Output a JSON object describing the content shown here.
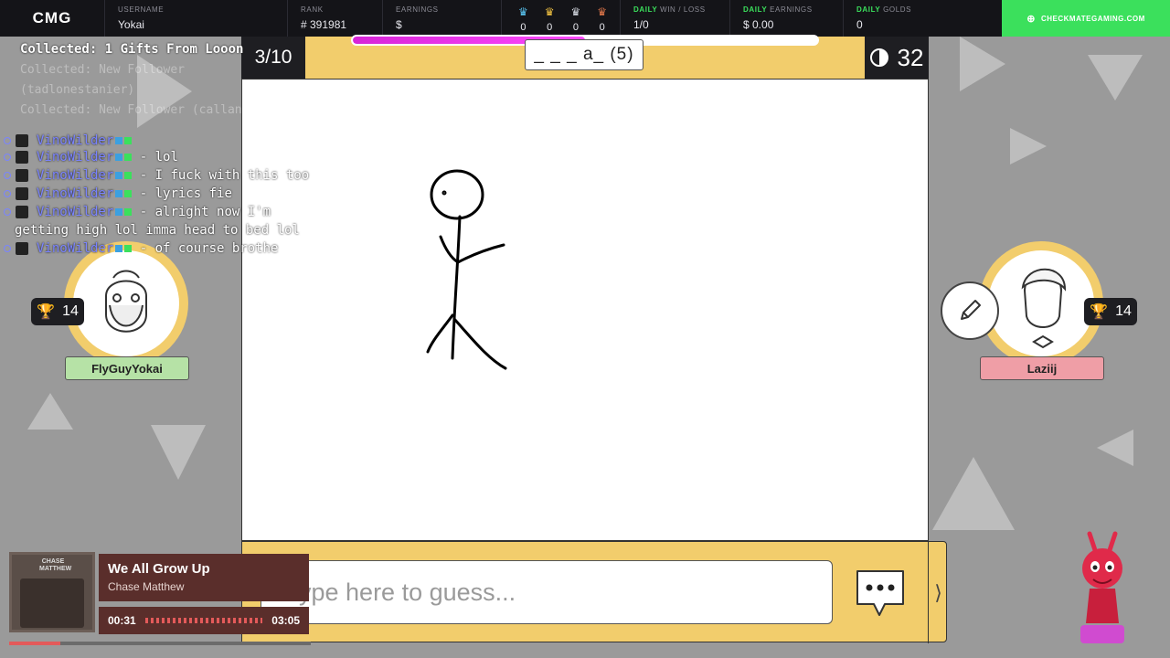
{
  "topbar": {
    "brand": "CMG",
    "username_label": "USERNAME",
    "username": "Yokai",
    "rank_label": "RANK",
    "rank": "# 391981",
    "earnings_label": "EARNINGS",
    "earnings": "$",
    "crowns": [
      {
        "icon": "crown-icon",
        "color": "#5bc8f5",
        "value": "0"
      },
      {
        "icon": "crown-icon",
        "color": "#f5c542",
        "value": "0"
      },
      {
        "icon": "crown-icon",
        "color": "#d7dbe3",
        "value": "0"
      },
      {
        "icon": "crown-icon",
        "color": "#e0774a",
        "value": "0"
      }
    ],
    "daily_wl_label_hl": "DAILY",
    "daily_wl_label": " WIN / LOSS",
    "daily_wl": "1/0",
    "daily_earn_label_hl": "DAILY",
    "daily_earn_label": " EARNINGS",
    "daily_earn": "$ 0.00",
    "daily_golds_label_hl": "DAILY",
    "daily_golds_label": " GOLDS",
    "daily_golds": "0",
    "cta": "CHECKMATEGAMING.COM"
  },
  "game": {
    "round": "3/10",
    "word_hint": "_ _ _ a_ (5)",
    "progress_fraction": 0.5,
    "timer": "32",
    "guess_placeholder": "Type here to guess..."
  },
  "players": {
    "left": {
      "name": "FlyGuyYokai",
      "trophies": "14",
      "name_color": "#b6e2a6"
    },
    "right": {
      "name": "Laziij",
      "trophies": "14",
      "name_color": "#ef9ea6"
    }
  },
  "chat": {
    "collected_label": "Collected:",
    "collected_text": "1 Gifts From Looon",
    "faded": [
      "Collected: New Follower",
      "(tadlonestanier)",
      "Collected: New Follower (callan15)"
    ],
    "messages": [
      {
        "user": "VinoWilder",
        "text": ""
      },
      {
        "user": "VinoWilder",
        "text": "- lol"
      },
      {
        "user": "VinoWilder",
        "text": "- I fuck with this too"
      },
      {
        "user": "VinoWilder",
        "text": "- lyrics fie"
      },
      {
        "user": "VinoWilder",
        "text": "- alright now I'm getting high lol imma head to bed lol"
      },
      {
        "user": "VinoWilder",
        "text": "- of course brothe"
      }
    ]
  },
  "music": {
    "title": "We All Grow Up",
    "artist": "Chase Matthew",
    "elapsed": "00:31",
    "duration": "03:05",
    "album_text": "CHASE MATTHEW"
  },
  "colors": {
    "accent_green": "#3be05c",
    "game_yellow": "#f2cd6c",
    "progress_magenta": "#d724d7"
  }
}
